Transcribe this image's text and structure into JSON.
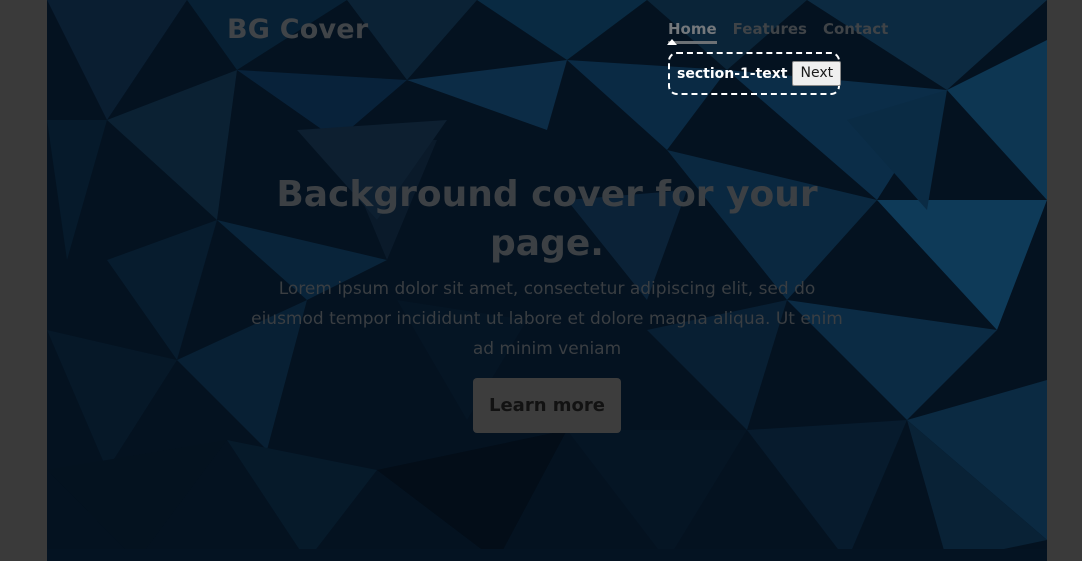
{
  "header": {
    "brand": "BG Cover",
    "nav": [
      {
        "label": "Home",
        "active": true
      },
      {
        "label": "Features",
        "active": false
      },
      {
        "label": "Contact",
        "active": false
      }
    ]
  },
  "tour": {
    "step_label": "section-1-text",
    "next_label": "Next"
  },
  "hero": {
    "title": "Background cover for your page.",
    "text": "Lorem ipsum dolor sit amet, consectetur adipiscing elit, sed do eiusmod tempor incididunt ut labore et dolore magna aliqua. Ut enim ad minim veniam",
    "button_label": "Learn more"
  },
  "colors": {
    "page_background": "#3a3a3a",
    "cover_background": "#041220",
    "overlay_white": "#ffffff"
  }
}
